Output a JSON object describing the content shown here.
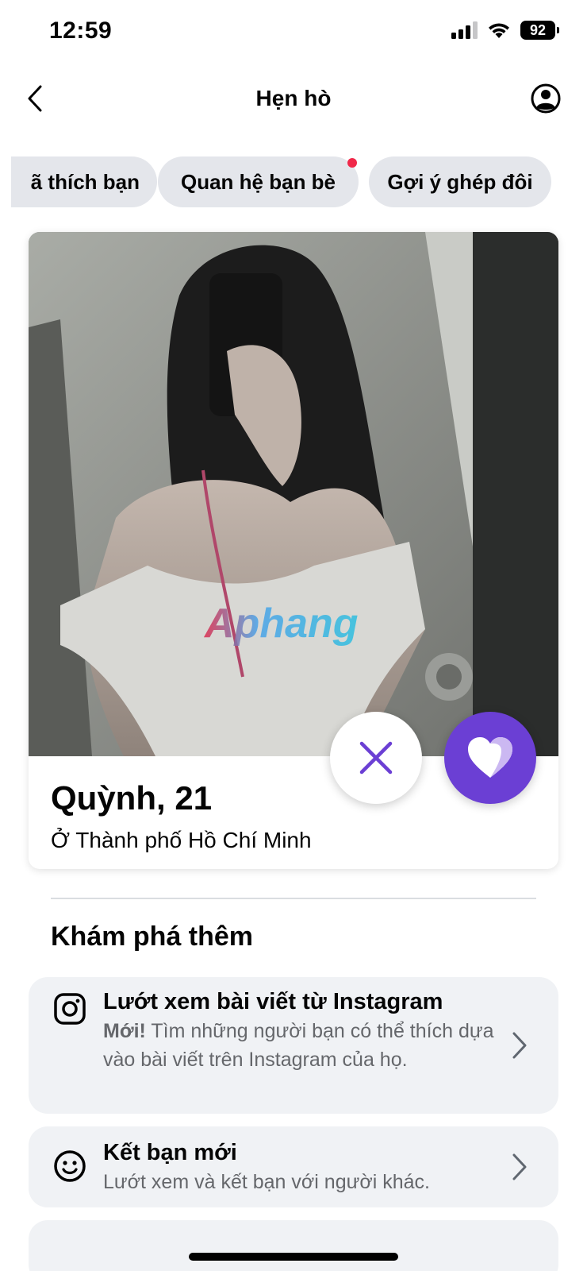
{
  "status_bar": {
    "time": "12:59",
    "battery": "92"
  },
  "header": {
    "title": "Hẹn hò"
  },
  "chips": [
    {
      "label": "ã thích bạn"
    },
    {
      "label": "Quan hệ bạn bè",
      "has_notification": true
    },
    {
      "label": "Gợi ý ghép đôi"
    }
  ],
  "profile": {
    "name_age": "Quỳnh, 21",
    "location": "Ở Thành phố Hồ Chí Minh",
    "watermark": "Aphang"
  },
  "section": {
    "title": "Khám phá thêm"
  },
  "options": [
    {
      "icon": "instagram-icon",
      "title": "Lướt xem bài viết từ Instagram",
      "badge": "Mới!",
      "description": "Tìm những người bạn có thể thích dựa vào bài viết trên Instagram của họ."
    },
    {
      "icon": "smiley-icon",
      "title": "Kết bạn mới",
      "description": "Lướt xem và kết bạn với người khác."
    }
  ],
  "colors": {
    "accent": "#6b3fd4",
    "chip_bg": "#e4e6eb",
    "card_bg": "#f0f2f5",
    "notification": "#f02849"
  }
}
